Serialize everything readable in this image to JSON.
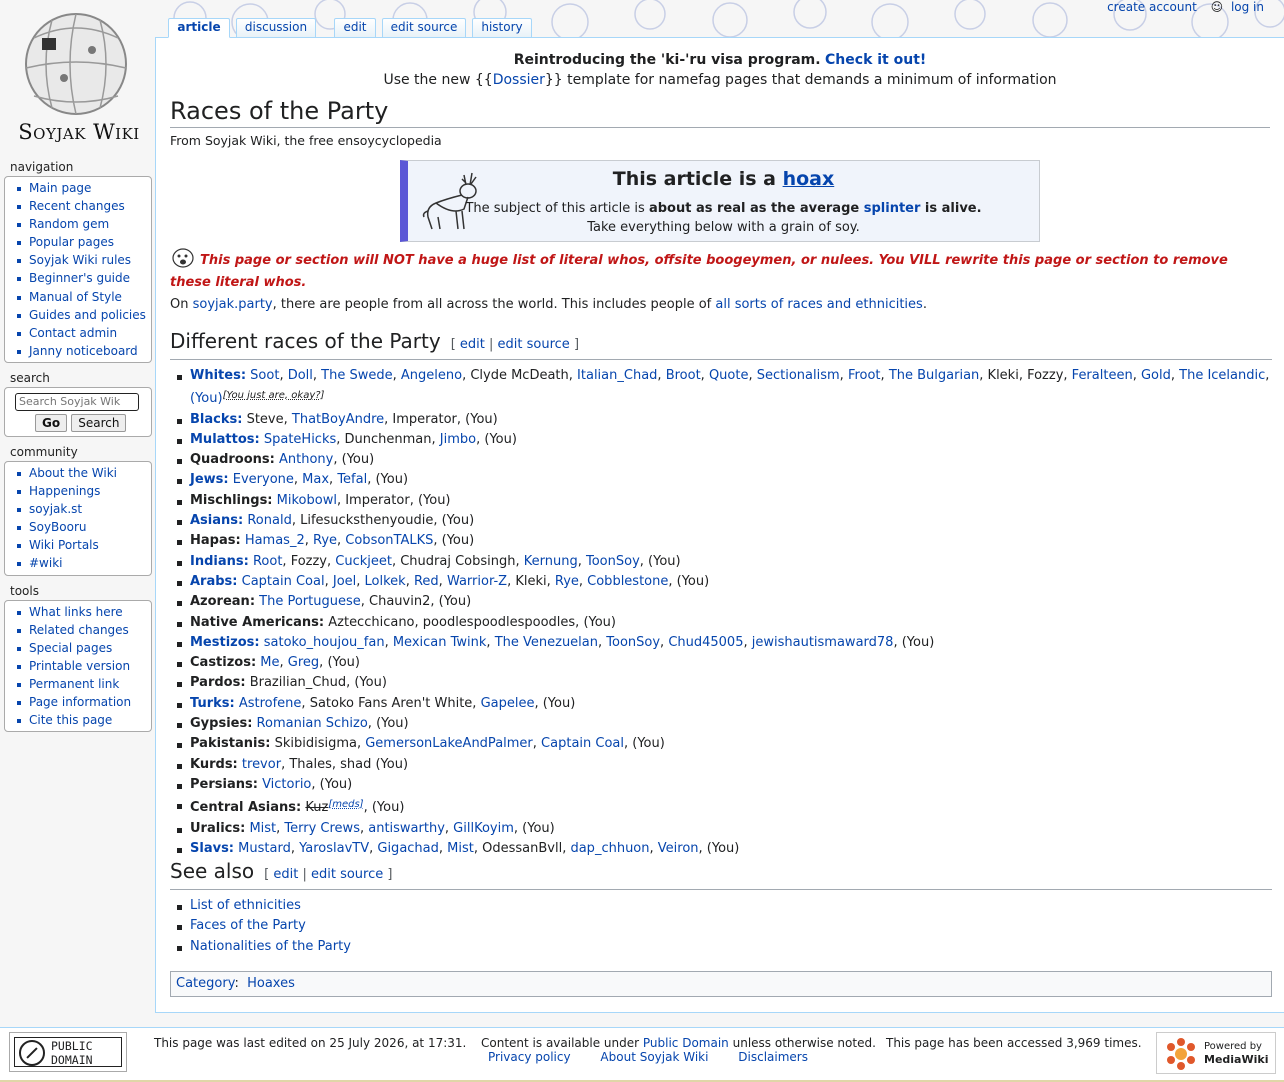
{
  "site": {
    "name": "Soyjak Wiki"
  },
  "personal": {
    "create_account": "create account",
    "log_in": "log in"
  },
  "tabs": {
    "article": "article",
    "discussion": "discussion",
    "edit": "edit",
    "edit_source": "edit source",
    "history": "history"
  },
  "sitenotice": {
    "line1_bold": "Reintroducing the 'ki-'ru visa program.",
    "line1_link": "Check it out!",
    "line2_pre": "Use the new {{",
    "line2_link": "Dossier",
    "line2_post": "}} template for namefag pages that demands a minimum of information"
  },
  "page": {
    "title": "Races of the Party",
    "subtitle": "From Soyjak Wiki, the free ensoycyclopedia"
  },
  "hoax": {
    "title_pre": "This article is a ",
    "title_link": "hoax",
    "l1_pre": "The subject of this article is ",
    "l1_bold": "about as real as the average ",
    "l1_link": "splinter",
    "l1_post": " is alive.",
    "l2": "Take everything below with a grain of soy."
  },
  "warning": "This page or section will NOT have a huge list of literal whos, offsite boogeymen, or nulees. You VILL rewrite this page or section to remove these literal whos.",
  "intro": {
    "pre": "On ",
    "link1": "soyjak.party",
    "mid": ", there are people from all across the world. This includes people of ",
    "link2": "all sorts of races and ethnicities",
    "post": "."
  },
  "sections": {
    "races": "Different races of the Party",
    "see_also": "See also",
    "edit": "edit",
    "edit_source": "edit source"
  },
  "races": [
    {
      "label": "Whites:",
      "label_link": true,
      "members": [
        {
          "t": "Soot",
          "l": 1
        },
        {
          "t": "Doll",
          "l": 1
        },
        {
          "t": "The Swede",
          "l": 1
        },
        {
          "t": "Angeleno",
          "l": 1
        },
        {
          "t": "Clyde McDeath",
          "l": 0
        },
        {
          "t": "Italian_Chad",
          "l": 1
        },
        {
          "t": "Broot",
          "l": 1
        },
        {
          "t": "Quote",
          "l": 1
        },
        {
          "t": "Sectionalism",
          "l": 1
        },
        {
          "t": "Froot",
          "l": 1
        },
        {
          "t": "The Bulgarian",
          "l": 1
        },
        {
          "t": "Kleki",
          "l": 0
        },
        {
          "t": "Fozzy",
          "l": 0
        },
        {
          "t": "Feralteen",
          "l": 1
        },
        {
          "t": "Gold",
          "l": 1
        },
        {
          "t": "The Icelandic",
          "l": 1
        },
        {
          "t": "(You)",
          "l": 1,
          "sup": "[You just are, okay?]"
        }
      ]
    },
    {
      "label": "Blacks:",
      "label_link": true,
      "members": [
        {
          "t": "Steve",
          "l": 0
        },
        {
          "t": "ThatBoyAndre",
          "l": 1
        },
        {
          "t": "Imperator",
          "l": 0
        },
        {
          "t": "(You)",
          "l": 0
        }
      ]
    },
    {
      "label": "Mulattos:",
      "label_link": true,
      "members": [
        {
          "t": "SpateHicks",
          "l": 1
        },
        {
          "t": "Dunchenman",
          "l": 0
        },
        {
          "t": "Jimbo",
          "l": 1
        },
        {
          "t": "(You)",
          "l": 0
        }
      ]
    },
    {
      "label": "Quadroons:",
      "label_link": false,
      "members": [
        {
          "t": "Anthony",
          "l": 1
        },
        {
          "t": "(You)",
          "l": 0
        }
      ]
    },
    {
      "label": "Jews:",
      "label_link": true,
      "members": [
        {
          "t": "Everyone",
          "l": 1
        },
        {
          "t": "Max",
          "l": 1
        },
        {
          "t": "Tefal",
          "l": 1
        },
        {
          "t": "(You)",
          "l": 0
        }
      ]
    },
    {
      "label": "Mischlings:",
      "label_link": false,
      "members": [
        {
          "t": "Mikobowl",
          "l": 1
        },
        {
          "t": "Imperator",
          "l": 0
        },
        {
          "t": "(You)",
          "l": 0
        }
      ]
    },
    {
      "label": "Asians:",
      "label_link": true,
      "members": [
        {
          "t": "Ronald",
          "l": 1
        },
        {
          "t": "Lifesucksthenyoudie",
          "l": 0
        },
        {
          "t": "(You)",
          "l": 0
        }
      ]
    },
    {
      "label": "Hapas:",
      "label_link": false,
      "members": [
        {
          "t": "Hamas_2",
          "l": 1
        },
        {
          "t": "Rye",
          "l": 1
        },
        {
          "t": "CobsonTALKS",
          "l": 1
        },
        {
          "t": "(You)",
          "l": 0
        }
      ]
    },
    {
      "label": "Indians:",
      "label_link": true,
      "members": [
        {
          "t": "Root",
          "l": 1
        },
        {
          "t": "Fozzy",
          "l": 0
        },
        {
          "t": "Cuckjeet",
          "l": 1
        },
        {
          "t": "Chudraj Cobsingh",
          "l": 0
        },
        {
          "t": "Kernung",
          "l": 1
        },
        {
          "t": "ToonSoy",
          "l": 1
        },
        {
          "t": "(You)",
          "l": 0
        }
      ]
    },
    {
      "label": "Arabs:",
      "label_link": true,
      "members": [
        {
          "t": "Captain Coal",
          "l": 1
        },
        {
          "t": "Joel",
          "l": 1
        },
        {
          "t": "Lolkek",
          "l": 1
        },
        {
          "t": "Red",
          "l": 1
        },
        {
          "t": "Warrior-Z",
          "l": 1
        },
        {
          "t": "Kleki",
          "l": 0
        },
        {
          "t": "Rye",
          "l": 1
        },
        {
          "t": "Cobblestone",
          "l": 1
        },
        {
          "t": "(You)",
          "l": 0
        }
      ]
    },
    {
      "label": "Azorean:",
      "label_link": false,
      "members": [
        {
          "t": "The Portuguese",
          "l": 1
        },
        {
          "t": "Chauvin2",
          "l": 0
        },
        {
          "t": "(You)",
          "l": 0
        }
      ]
    },
    {
      "label": "Native Americans:",
      "label_link": false,
      "members": [
        {
          "t": "Aztecchicano",
          "l": 0
        },
        {
          "t": "poodlespoodlespoodles",
          "l": 0
        },
        {
          "t": "(You)",
          "l": 0
        }
      ]
    },
    {
      "label": "Mestizos:",
      "label_link": true,
      "members": [
        {
          "t": "satoko_houjou_fan",
          "l": 1
        },
        {
          "t": "Mexican Twink",
          "l": 1
        },
        {
          "t": "The Venezuelan",
          "l": 1
        },
        {
          "t": "ToonSoy",
          "l": 1
        },
        {
          "t": "Chud45005",
          "l": 1
        },
        {
          "t": "jewishautismaward78",
          "l": 1
        },
        {
          "t": "(You)",
          "l": 0
        }
      ]
    },
    {
      "label": "Castizos:",
      "label_link": false,
      "members": [
        {
          "t": "Me",
          "l": 1
        },
        {
          "t": "Greg",
          "l": 1
        },
        {
          "t": "(You)",
          "l": 0
        }
      ]
    },
    {
      "label": "Pardos:",
      "label_link": false,
      "members": [
        {
          "t": "Brazilian_Chud",
          "l": 0
        },
        {
          "t": "(You)",
          "l": 0
        }
      ]
    },
    {
      "label": "Turks:",
      "label_link": true,
      "members": [
        {
          "t": "Astrofene",
          "l": 1
        },
        {
          "t": "Satoko Fans Aren't White",
          "l": 0
        },
        {
          "t": "Gapelee",
          "l": 1
        },
        {
          "t": "(You)",
          "l": 0
        }
      ]
    },
    {
      "label": "Gypsies:",
      "label_link": false,
      "members": [
        {
          "t": "Romanian Schizo",
          "l": 1
        },
        {
          "t": "(You)",
          "l": 0
        }
      ]
    },
    {
      "label": "Pakistanis:",
      "label_link": false,
      "members": [
        {
          "t": "Skibidisigma",
          "l": 0
        },
        {
          "t": "GemersonLakeAndPalmer",
          "l": 1
        },
        {
          "t": "Captain Coal",
          "l": 1
        },
        {
          "t": "(You)",
          "l": 0
        }
      ]
    },
    {
      "label": "Kurds:",
      "label_link": false,
      "members": [
        {
          "t": "trevor",
          "l": 1
        },
        {
          "t": "Thales",
          "l": 0
        },
        {
          "t": "shad (You)",
          "l": 0
        }
      ]
    },
    {
      "label": "Persians:",
      "label_link": false,
      "members": [
        {
          "t": "Victorio",
          "l": 1
        },
        {
          "t": "(You)",
          "l": 0
        }
      ]
    },
    {
      "label": "Central Asians:",
      "label_link": false,
      "members": [
        {
          "t": "Kuz",
          "l": 0,
          "strike": 1,
          "sup": "[meds]"
        },
        {
          "t": "(You)",
          "l": 0
        }
      ]
    },
    {
      "label": "Uralics:",
      "label_link": false,
      "members": [
        {
          "t": "Mist",
          "l": 1
        },
        {
          "t": "Terry Crews",
          "l": 1
        },
        {
          "t": "antiswarthy",
          "l": 1
        },
        {
          "t": "GillKoyim",
          "l": 1
        },
        {
          "t": "(You)",
          "l": 0
        }
      ]
    },
    {
      "label": "Slavs:",
      "label_link": true,
      "members": [
        {
          "t": "Mustard",
          "l": 1
        },
        {
          "t": "YaroslavTV",
          "l": 1
        },
        {
          "t": "Gigachad",
          "l": 1
        },
        {
          "t": "Mist",
          "l": 1
        },
        {
          "t": "OdessanBvll",
          "l": 0
        },
        {
          "t": "dap_chhuon",
          "l": 1
        },
        {
          "t": "Veiron",
          "l": 1
        },
        {
          "t": "(You)",
          "l": 0
        }
      ]
    }
  ],
  "see_also": [
    "List of ethnicities",
    "Faces of the Party",
    "Nationalities of the Party"
  ],
  "category": {
    "label": "Category",
    "value": "Hoaxes"
  },
  "sidebar": {
    "navigation": {
      "heading": "navigation",
      "items": [
        "Main page",
        "Recent changes",
        "Random gem",
        "Popular pages",
        "Soyjak Wiki rules",
        "Beginner's guide",
        "Manual of Style",
        "Guides and policies",
        "Contact admin",
        "Janny noticeboard"
      ]
    },
    "search": {
      "heading": "search",
      "placeholder": "Search Soyjak Wik",
      "go": "Go",
      "search": "Search"
    },
    "community": {
      "heading": "community",
      "items": [
        "About the Wiki",
        "Happenings",
        "soyjak.st",
        "SoyBooru",
        "Wiki Portals",
        "#wiki"
      ]
    },
    "tools": {
      "heading": "tools",
      "items": [
        "What links here",
        "Related changes",
        "Special pages",
        "Printable version",
        "Permanent link",
        "Page information",
        "Cite this page"
      ]
    }
  },
  "footer": {
    "pd_line1": "PUBLIC",
    "pd_line2": "DOMAIN",
    "lastmod": "This page was last edited on 25 July 2026, at 17:31.",
    "license_pre": "Content is available under ",
    "license_link": "Public Domain",
    "license_post": " unless otherwise noted.",
    "accessed": "This page has been accessed 3,969 times.",
    "links": [
      "Privacy policy",
      "About Soyjak Wiki",
      "Disclaimers"
    ],
    "powered_1": "Powered by",
    "powered_2": "MediaWiki"
  },
  "colors": {
    "link": "#0645ad",
    "warning": "#c01616",
    "hoax_bar": "#5b57d6",
    "border": "#a7d7f9"
  }
}
